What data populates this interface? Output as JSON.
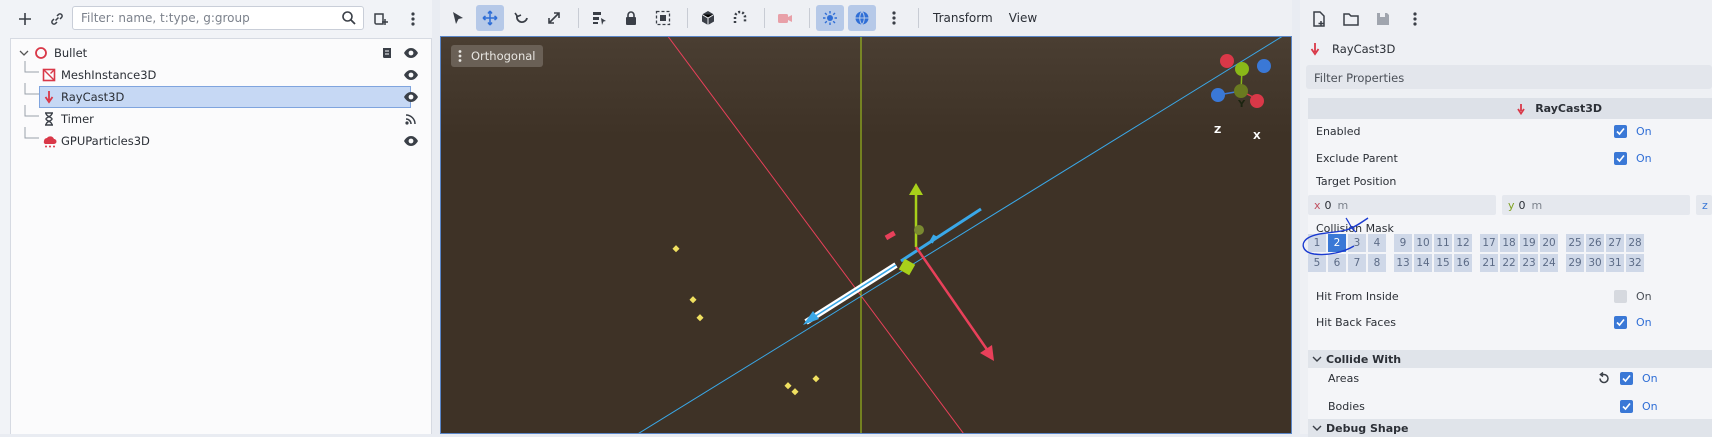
{
  "scene": {
    "filter_placeholder": "Filter: name, t:type, g:group",
    "nodes": [
      {
        "label": "Bullet",
        "icon": "node3d-icon"
      },
      {
        "label": "MeshInstance3D",
        "icon": "mesh-instance-icon"
      },
      {
        "label": "RayCast3D",
        "icon": "raycast-icon"
      },
      {
        "label": "Timer",
        "icon": "timer-icon"
      },
      {
        "label": "GPUParticles3D",
        "icon": "particles-icon"
      }
    ]
  },
  "viewport": {
    "projection_label": "Orthogonal",
    "menu_transform": "Transform",
    "menu_view": "View",
    "gizmo": {
      "y": "Y",
      "z": "Z",
      "x": "X"
    }
  },
  "inspector": {
    "node_title": "RayCast3D",
    "filter_placeholder": "Filter Properties",
    "category": "RayCast3D",
    "enabled_label": "Enabled",
    "enabled_value": "On",
    "exclude_parent_label": "Exclude Parent",
    "exclude_parent_value": "On",
    "target_position_label": "Target Position",
    "target_x_axis": "x",
    "target_x": "0",
    "target_x_unit": "m",
    "target_y_axis": "y",
    "target_y": "0",
    "target_y_unit": "m",
    "target_z_axis": "z",
    "collision_mask_label": "Collision Mask",
    "mask_groups": [
      {
        "top": [
          "1",
          "2",
          "3",
          "4"
        ],
        "bottom": [
          "5",
          "6",
          "7",
          "8"
        ]
      },
      {
        "top": [
          "9",
          "10",
          "11",
          "12"
        ],
        "bottom": [
          "13",
          "14",
          "15",
          "16"
        ]
      },
      {
        "top": [
          "17",
          "18",
          "19",
          "20"
        ],
        "bottom": [
          "21",
          "22",
          "23",
          "24"
        ]
      },
      {
        "top": [
          "25",
          "26",
          "27",
          "28"
        ],
        "bottom": [
          "29",
          "30",
          "31",
          "32"
        ]
      }
    ],
    "mask_active": [
      "2"
    ],
    "hit_from_inside_label": "Hit From Inside",
    "hit_from_inside_value": "On",
    "hit_back_faces_label": "Hit Back Faces",
    "hit_back_faces_value": "On",
    "collide_with_label": "Collide With",
    "areas_label": "Areas",
    "areas_value": "On",
    "bodies_label": "Bodies",
    "bodies_value": "On",
    "debug_shape_label": "Debug Shape"
  },
  "colors": {
    "accent": "#3a78d6",
    "viewport_bg": "#3e3226",
    "selection": "#c6d8f4"
  }
}
